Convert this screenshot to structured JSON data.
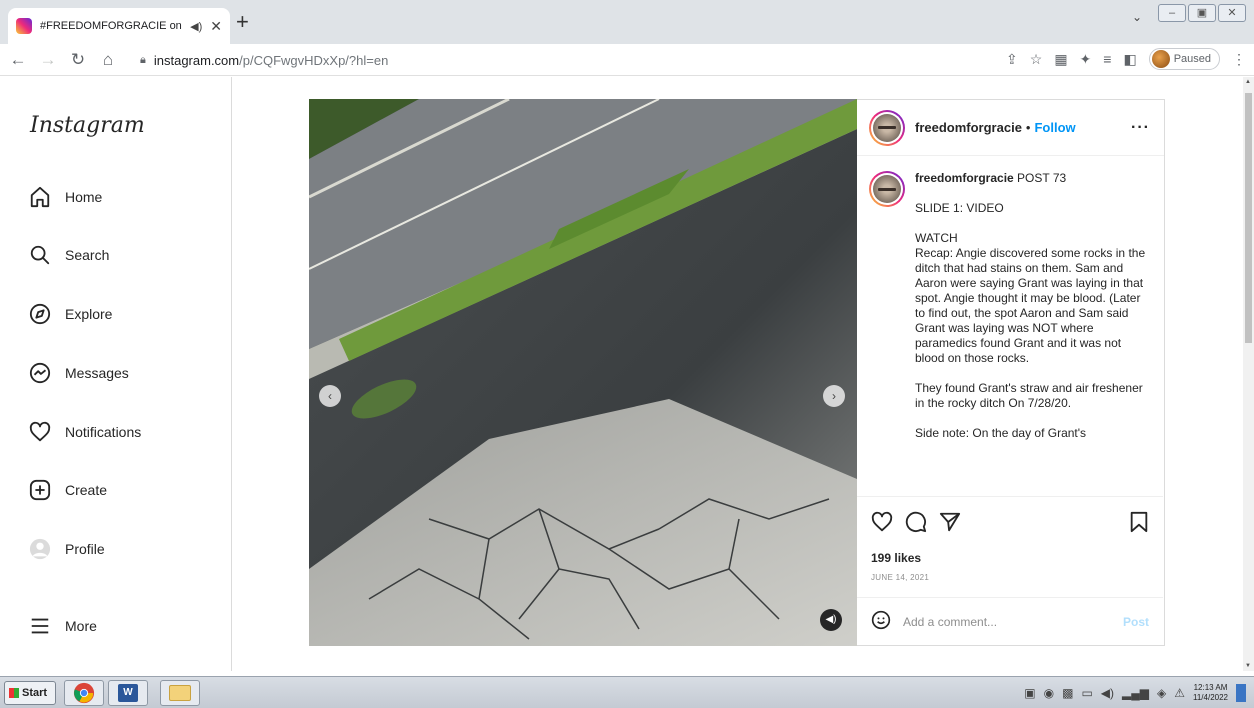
{
  "browser": {
    "tab_title": "#FREEDOMFORGRACIE on Ins",
    "new_tab": "+",
    "url_host": "instagram.com",
    "url_path": "/p/CQFwgvHDxXp/?hl=en",
    "profile_status": "Paused"
  },
  "sidebar": {
    "logo": "Instagram",
    "items": [
      {
        "label": "Home",
        "icon": "home-icon"
      },
      {
        "label": "Search",
        "icon": "search-icon"
      },
      {
        "label": "Explore",
        "icon": "compass-icon"
      },
      {
        "label": "Messages",
        "icon": "messenger-icon"
      },
      {
        "label": "Notifications",
        "icon": "heart-icon"
      },
      {
        "label": "Create",
        "icon": "plus-square-icon"
      },
      {
        "label": "Profile",
        "icon": "avatar-icon"
      },
      {
        "label": "More",
        "icon": "hamburger-icon"
      }
    ]
  },
  "post": {
    "username": "freedomforgracie",
    "separator": "•",
    "follow_label": "Follow",
    "more": "···",
    "caption_username": "freedomforgracie",
    "caption_paragraphs": [
      "POST 73",
      "SLIDE 1: VIDEO",
      "WATCH\nRecap: Angie discovered some rocks in the ditch that had stains on them. Sam and Aaron were saying Grant was laying in that spot. Angie thought it may be blood. (Later to find out, the spot Aaron and Sam said Grant was laying was NOT where paramedics found Grant and it was not blood on those rocks.",
      "They found Grant's straw and air freshener in the rocky ditch On 7/28/20.",
      "Side note: On the day of Grant's"
    ],
    "likes": "199 likes",
    "date": "JUNE 14, 2021",
    "comment_placeholder": "Add a comment...",
    "post_button": "Post"
  },
  "taskbar": {
    "start_label": "Start",
    "clock_time": "12:13 AM",
    "clock_date": "11/4/2022"
  }
}
